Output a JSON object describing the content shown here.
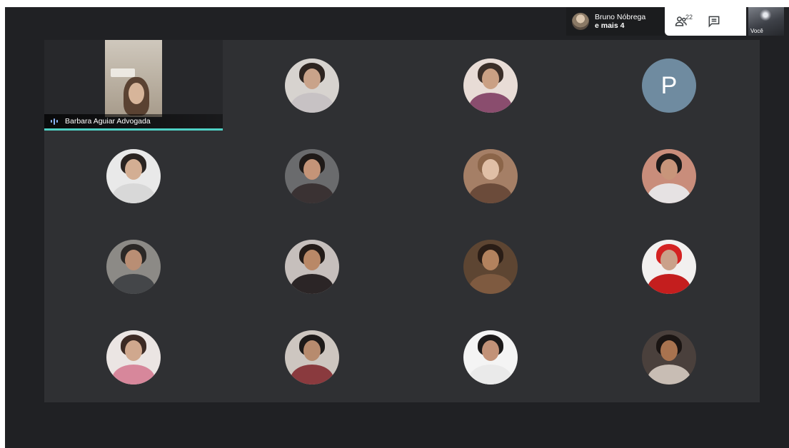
{
  "presenter": {
    "name": "Bruno Nóbrega",
    "more": "e mais 4"
  },
  "controls": {
    "people_count": "22",
    "people_icon": "people-icon",
    "chat_icon": "chat-icon"
  },
  "self_view": {
    "label": "Você"
  },
  "speaker": {
    "name": "Barbara Aguiar Advogada"
  },
  "letter_participant": {
    "initial": "P",
    "color": "#6f8ba0"
  },
  "accent": {
    "speaking": "#4fd1c5",
    "background": "#202124"
  }
}
